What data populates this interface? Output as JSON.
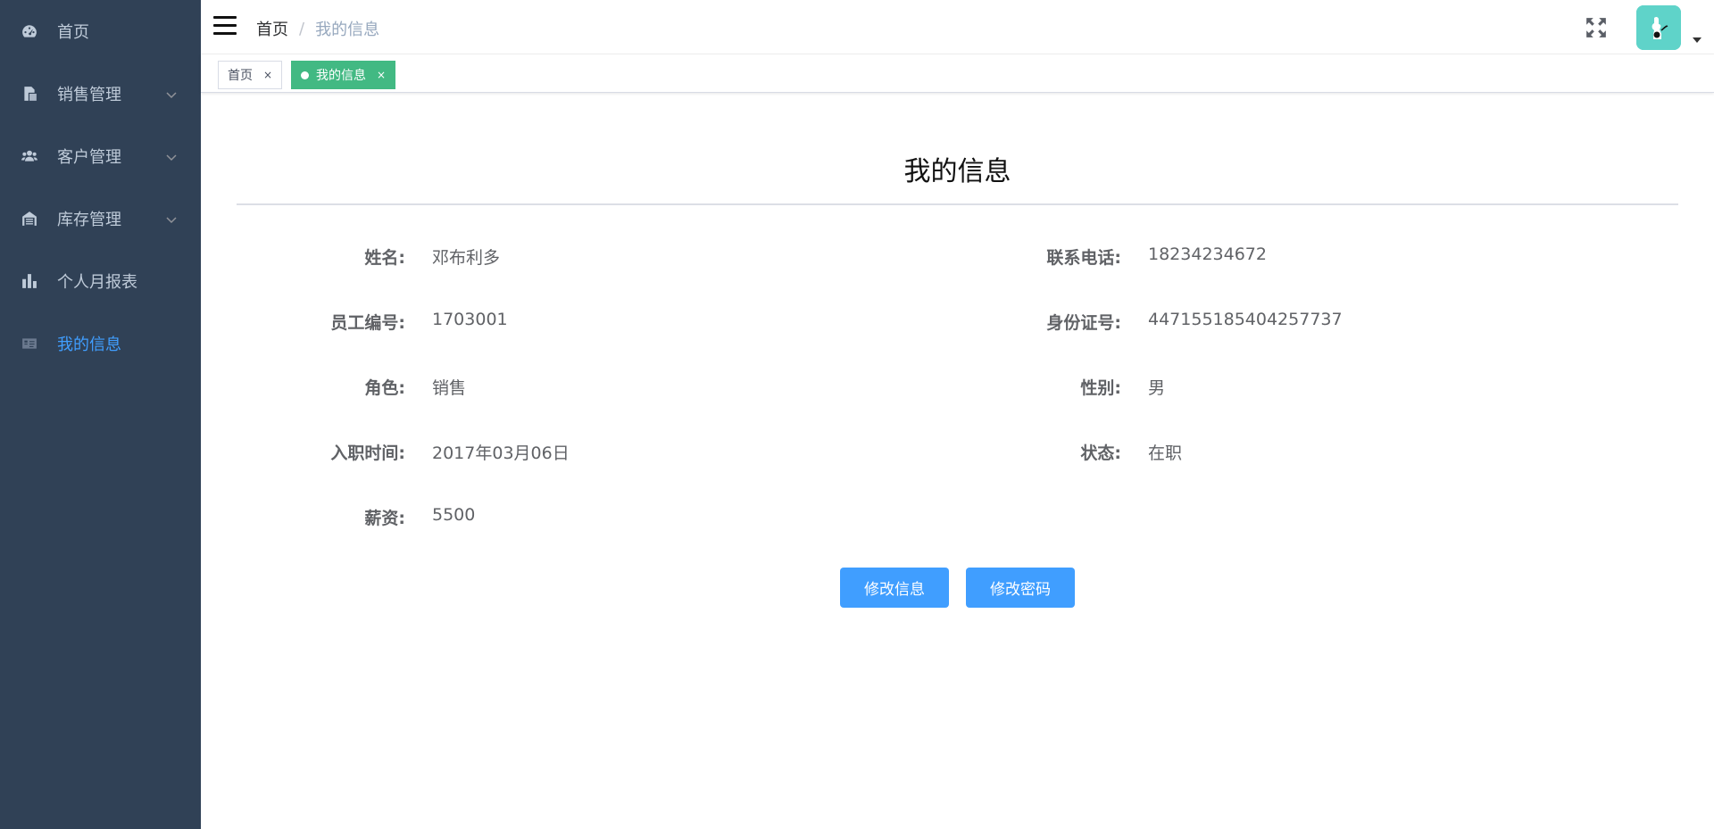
{
  "sidebar": {
    "items": [
      {
        "label": "首页",
        "icon": "dashboard-icon"
      },
      {
        "label": "销售管理",
        "icon": "documents-icon"
      },
      {
        "label": "客户管理",
        "icon": "users-icon"
      },
      {
        "label": "库存管理",
        "icon": "warehouse-icon"
      },
      {
        "label": "个人月报表",
        "icon": "bar-chart-icon"
      },
      {
        "label": "我的信息",
        "icon": "id-card-icon",
        "active": true
      }
    ]
  },
  "navbar": {
    "breadcrumb": {
      "home": "首页",
      "separator": "/",
      "current": "我的信息"
    }
  },
  "tags": [
    {
      "label": "首页",
      "close": "×"
    },
    {
      "label": "我的信息",
      "close": "×",
      "active": true
    }
  ],
  "main": {
    "title": "我的信息",
    "fields": {
      "name": {
        "label": "姓名:",
        "value": "邓布利多"
      },
      "phone": {
        "label": "联系电话:",
        "value": "18234234672"
      },
      "employee_no": {
        "label": "员工编号:",
        "value": "1703001"
      },
      "id_number": {
        "label": "身份证号:",
        "value": "447155185404257737"
      },
      "role": {
        "label": "角色:",
        "value": "销售"
      },
      "gender": {
        "label": "性别:",
        "value": "男"
      },
      "hire_date": {
        "label": "入职时间:",
        "value": "2017年03月06日"
      },
      "status": {
        "label": "状态:",
        "value": "在职"
      },
      "salary": {
        "label": "薪资:",
        "value": "5500"
      }
    },
    "buttons": {
      "edit_info": "修改信息",
      "change_password": "修改密码"
    }
  },
  "colors": {
    "sidebar_bg": "#304156",
    "sidebar_text": "#bfcbd9",
    "active_menu": "#409eff",
    "active_tag": "#42b983",
    "primary_button": "#409eff",
    "avatar_bg": "#5fd3c9"
  }
}
